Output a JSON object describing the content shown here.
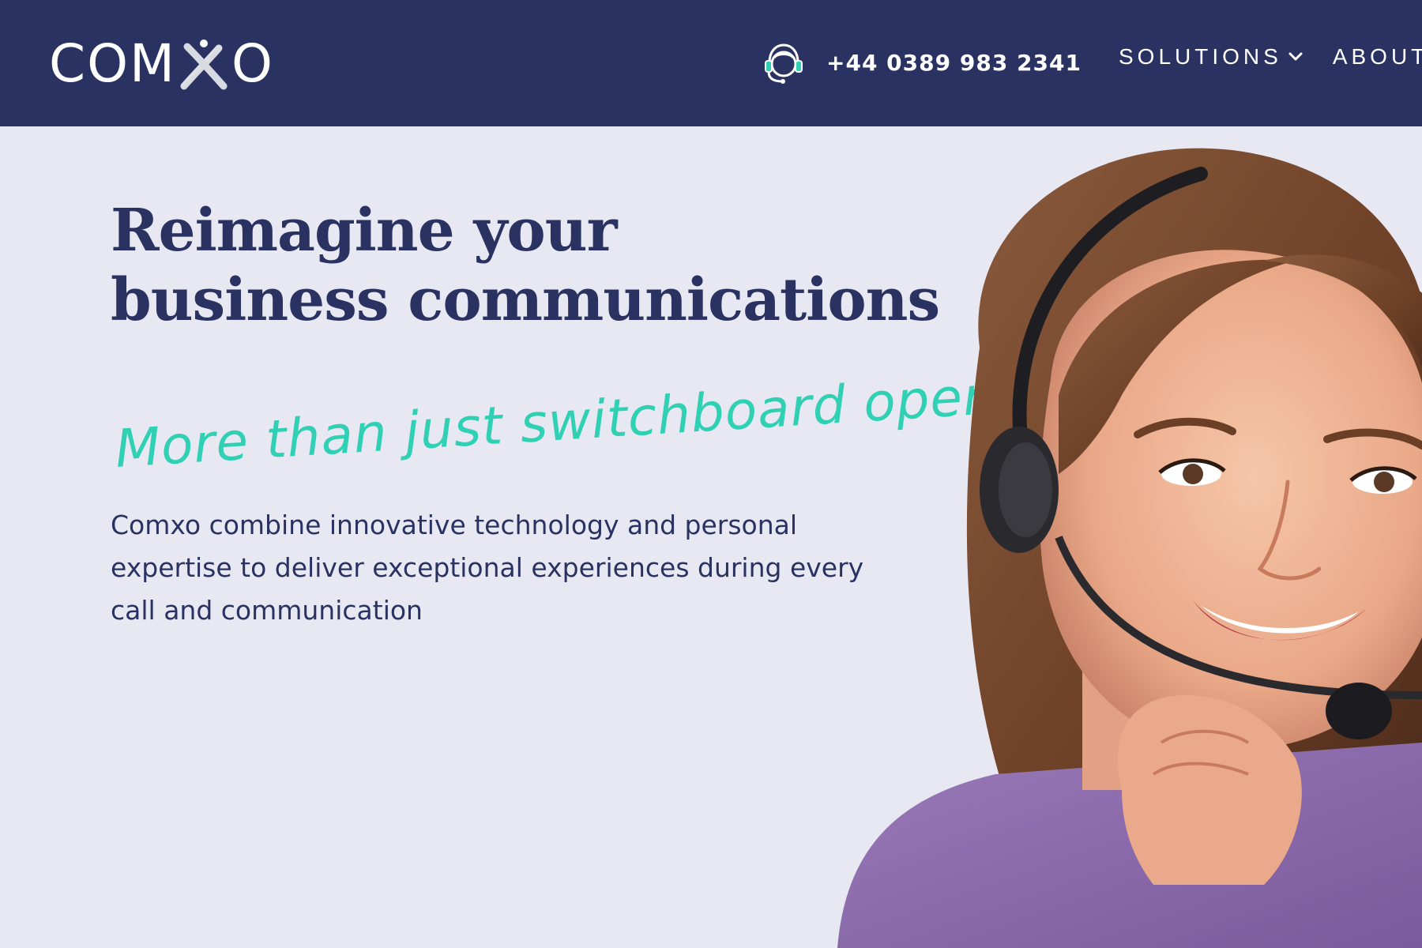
{
  "header": {
    "logo_text_left": "COM",
    "logo_text_right": "O",
    "logo_mark": "x-mark-icon",
    "phone": {
      "icon": "headset-icon",
      "number": "+44 0389 983 2341"
    },
    "nav": [
      {
        "label": "SOLUTIONS",
        "has_dropdown": true
      },
      {
        "label": "ABOUT",
        "has_dropdown": false
      }
    ]
  },
  "hero": {
    "title_line1": "Reimagine your",
    "title_line2": "business communications",
    "tagline": "More than just switchboard operators",
    "body": "Comxo combine innovative technology and personal expertise to deliver exceptional experiences during every call and communication",
    "image": "smiling-operator-with-headset-photo"
  },
  "colors": {
    "header_bg": "#2a3262",
    "page_bg": "#e8e8f3",
    "heading": "#2a3262",
    "accent": "#2fd0b4",
    "text": "#2a3262"
  }
}
